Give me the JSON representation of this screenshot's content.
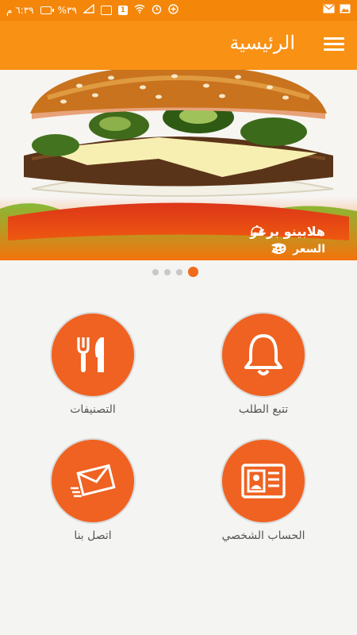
{
  "status_bar": {
    "time": "٦:٣٩ م",
    "battery": "%٣٩",
    "notification_count": "1"
  },
  "app_bar": {
    "title": "الرئيسية",
    "menu_icon": "hamburger-menu-icon"
  },
  "banner": {
    "item_name": "هلابينو برغر",
    "price_label": "السعر",
    "price_value": "20",
    "name_icon": "cloche-icon",
    "price_icon": "coins-stack-icon",
    "slide_count": 4,
    "active_slide": 4
  },
  "menu": {
    "track_order": {
      "label": "تتبع الطلب",
      "icon": "bell-icon"
    },
    "categories": {
      "label": "التصنيفات",
      "icon": "fork-knife-icon"
    },
    "profile": {
      "label": "الحساب الشخصي",
      "icon": "id-card-icon"
    },
    "contact": {
      "label": "اتصل بنا",
      "icon": "envelope-icon"
    }
  },
  "colors": {
    "status_bar": "#f4860a",
    "app_bar": "#f89114",
    "accent": "#ef6221",
    "background": "#f4f4f2"
  }
}
